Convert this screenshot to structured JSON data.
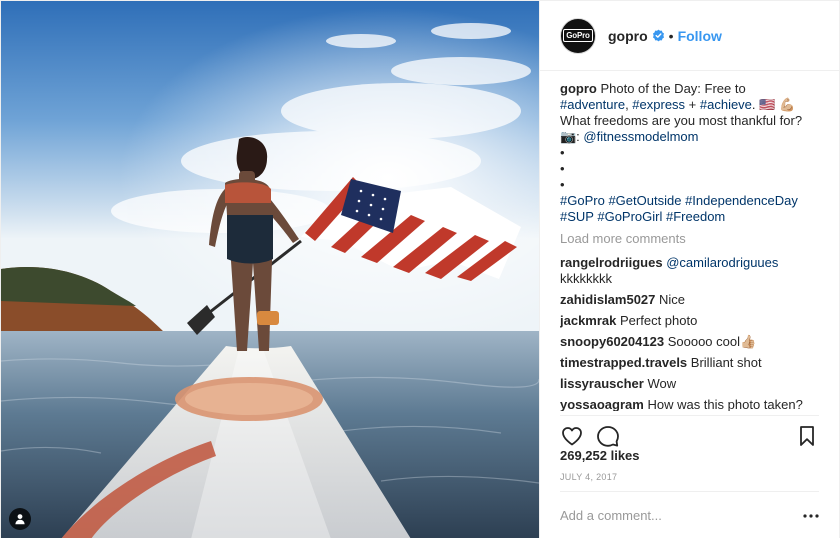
{
  "post": {
    "author": {
      "username": "gopro",
      "avatar_logo": "GoPro",
      "verified": true,
      "follow_label": "Follow",
      "separator": "•"
    },
    "photo": {
      "icons": {
        "tag": "user-tag-icon"
      }
    },
    "caption": {
      "username": "gopro",
      "text_1": "Photo of the Day: Free to",
      "tag_adventure": "#adventure",
      "sep_1": ", ",
      "tag_express": "#express",
      "sep_2": " + ",
      "tag_achieve": "#achieve",
      "emoji_line_1": ". 🇺🇸 💪🏼",
      "line_2": "What freedoms are you most thankful for?",
      "camera_prefix": "📷: ",
      "mention": "@fitnessmodelmom",
      "bullets": [
        "•",
        "•",
        "•"
      ],
      "hashtags_line_1": [
        "#GoPro",
        "#GetOutside",
        "#IndependenceDay"
      ],
      "hashtags_line_2": [
        "#SUP",
        "#GoProGirl",
        "#Freedom"
      ]
    },
    "load_more_label": "Load more comments",
    "comments": [
      {
        "user": "rangelrodriigues",
        "mention": "@camilarodriguues",
        "text": "kkkkkkkk"
      },
      {
        "user": "zahidislam5027",
        "text": "Nice"
      },
      {
        "user": "jackmrak",
        "text": "Perfect photo"
      },
      {
        "user": "snoopy60204123",
        "text": "Sooooo cool👍🏼"
      },
      {
        "user": "timestrapped.travels",
        "text": "Brilliant shot"
      },
      {
        "user": "lissyrauscher",
        "text": "Wow"
      },
      {
        "user": "yossaoagram",
        "text": "How was this photo taken?"
      }
    ],
    "actions": {
      "like_icon": "heart-icon",
      "comment_icon": "comment-bubble-icon",
      "save_icon": "bookmark-icon"
    },
    "likes_label": "269,252 likes",
    "date_label": "JULY 4, 2017",
    "add_comment_placeholder": "Add a comment...",
    "more_icon": "more-options-icon",
    "colors": {
      "accent": "#3897f0",
      "link": "#003569",
      "muted": "#999999",
      "text": "#262626",
      "border": "#efefef"
    }
  }
}
